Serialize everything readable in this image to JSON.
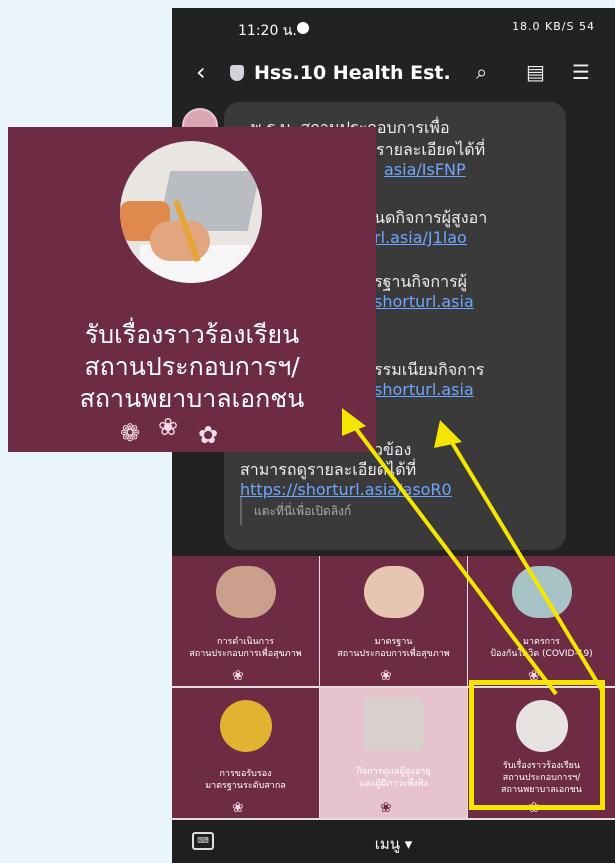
{
  "status": {
    "time": "11:20 น.",
    "right": "18.0 KB/S 54"
  },
  "header": {
    "back": "‹",
    "title": "Hss.10 Health Est.",
    "search_icon": "⌕",
    "note_icon": "▤",
    "menu_icon": "☰"
  },
  "message": {
    "lines": [
      "- พ.ร.บ. สถานประกอบการเพื่อ",
      "รายละเอียดได้ที่",
      "asia/IsFNP",
      "นดกิจการผู้สูงอา",
      "rl.asia/J1lao",
      "รฐานกิจการผู้",
      "shorturl.asia",
      "รรมเนียมกิจการ",
      "shorturl.asia",
      "วข้อง",
      "สามารถดูรายละเอียดได้ที่",
      "https://shorturl.asia/asoR0"
    ],
    "hint": "แตะที่นี่เพื่อเปิดลิงก์"
  },
  "grid": [
    {
      "caption1": "การดำเนินการ",
      "caption2": "สถานประกอบการเพื่อสุขภาพ"
    },
    {
      "caption1": "มาตรฐาน",
      "caption2": "สถานประกอบการเพื่อสุขภาพ"
    },
    {
      "caption1": "มาตรการ",
      "caption2": "ป้องกันโควิด (COVID-19)"
    },
    {
      "caption1": "การขอรับรอง",
      "caption2": "มาตรฐานระดับสากล"
    },
    {
      "caption1": "กิจการดูแลผู้สูงอายุ",
      "caption2": "และผู้มีภาวะพึ่งพิง"
    },
    {
      "caption1": "รับเรื่องราวร้องเรียน",
      "caption2": "สถานประกอบการฯ/",
      "caption3": "สถานพยาบาลเอกชน"
    }
  ],
  "menu": {
    "label": "เมนู ▾"
  },
  "zoom": {
    "line1": "รับเรื่องราวร้องเรียน",
    "line2": "สถานประกอบการฯ/",
    "line3": "สถานพยาบาลเอกชน"
  },
  "colors": {
    "brand": "#6e2b44",
    "highlight": "#f5e600",
    "link": "#6ea6ff"
  }
}
